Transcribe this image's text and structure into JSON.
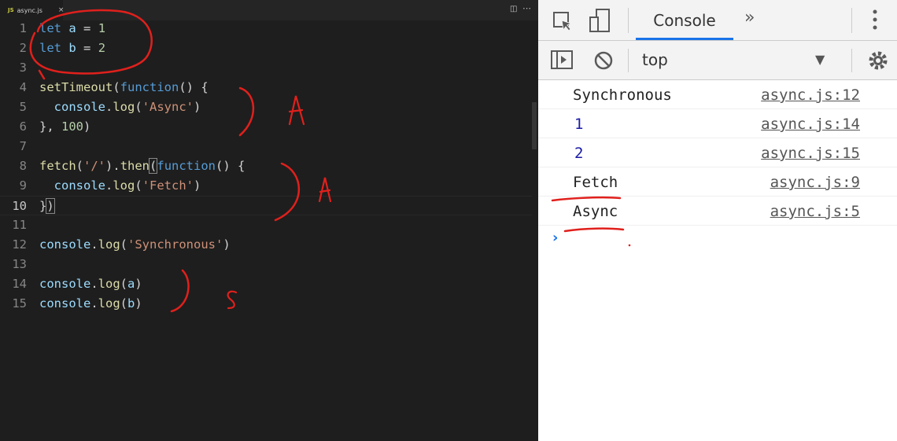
{
  "editor": {
    "tab": {
      "badge": "JS",
      "filename": "async.js",
      "close": "×"
    },
    "lines": [
      {
        "n": "1",
        "tokens": [
          [
            "kw",
            "let"
          ],
          [
            "pun",
            " "
          ],
          [
            "var",
            "a"
          ],
          [
            "pun",
            " = "
          ],
          [
            "num",
            "1"
          ]
        ]
      },
      {
        "n": "2",
        "tokens": [
          [
            "kw",
            "let"
          ],
          [
            "pun",
            " "
          ],
          [
            "var",
            "b"
          ],
          [
            "pun",
            " = "
          ],
          [
            "num",
            "2"
          ]
        ]
      },
      {
        "n": "3",
        "tokens": []
      },
      {
        "n": "4",
        "tokens": [
          [
            "fn",
            "setTimeout"
          ],
          [
            "pun",
            "("
          ],
          [
            "kw",
            "function"
          ],
          [
            "pun",
            "() {"
          ]
        ]
      },
      {
        "n": "5",
        "tokens": [
          [
            "pun",
            "  "
          ],
          [
            "var",
            "console"
          ],
          [
            "pun",
            "."
          ],
          [
            "fn",
            "log"
          ],
          [
            "pun",
            "("
          ],
          [
            "str",
            "'Async'"
          ],
          [
            "pun",
            ")"
          ]
        ]
      },
      {
        "n": "6",
        "tokens": [
          [
            "pun",
            "}, "
          ],
          [
            "num",
            "100"
          ],
          [
            "pun",
            ")"
          ]
        ]
      },
      {
        "n": "7",
        "tokens": []
      },
      {
        "n": "8",
        "tokens": [
          [
            "fn",
            "fetch"
          ],
          [
            "pun",
            "("
          ],
          [
            "str",
            "'/'"
          ],
          [
            "pun",
            ")."
          ],
          [
            "fn",
            "then"
          ],
          [
            "brk",
            "("
          ],
          [
            "kw",
            "function"
          ],
          [
            "pun",
            "() {"
          ]
        ]
      },
      {
        "n": "9",
        "tokens": [
          [
            "pun",
            "  "
          ],
          [
            "var",
            "console"
          ],
          [
            "pun",
            "."
          ],
          [
            "fn",
            "log"
          ],
          [
            "pun",
            "("
          ],
          [
            "str",
            "'Fetch'"
          ],
          [
            "pun",
            ")"
          ]
        ]
      },
      {
        "n": "10",
        "tokens": [
          [
            "pun",
            "}"
          ],
          [
            "brk",
            ")"
          ]
        ],
        "current": true
      },
      {
        "n": "11",
        "tokens": []
      },
      {
        "n": "12",
        "tokens": [
          [
            "var",
            "console"
          ],
          [
            "pun",
            "."
          ],
          [
            "fn",
            "log"
          ],
          [
            "pun",
            "("
          ],
          [
            "str",
            "'Synchronous'"
          ],
          [
            "pun",
            ")"
          ]
        ]
      },
      {
        "n": "13",
        "tokens": []
      },
      {
        "n": "14",
        "tokens": [
          [
            "var",
            "console"
          ],
          [
            "pun",
            "."
          ],
          [
            "fn",
            "log"
          ],
          [
            "pun",
            "("
          ],
          [
            "var",
            "a"
          ],
          [
            "pun",
            ")"
          ]
        ]
      },
      {
        "n": "15",
        "tokens": [
          [
            "var",
            "console"
          ],
          [
            "pun",
            "."
          ],
          [
            "fn",
            "log"
          ],
          [
            "pun",
            "("
          ],
          [
            "var",
            "b"
          ],
          [
            "pun",
            ")"
          ]
        ]
      }
    ],
    "annotations": {
      "async_mark": "A",
      "sync_mark": "S",
      "ink_color": "#e0201c"
    }
  },
  "devtools": {
    "tabs": {
      "console": "Console"
    },
    "context": "top",
    "messages": [
      {
        "text": "Synchronous",
        "source": "async.js:12",
        "type": "string"
      },
      {
        "text": "1",
        "source": "async.js:14",
        "type": "number"
      },
      {
        "text": "2",
        "source": "async.js:15",
        "type": "number"
      },
      {
        "text": "Fetch",
        "source": "async.js:9",
        "type": "string"
      },
      {
        "text": "Async",
        "source": "async.js:5",
        "type": "string"
      }
    ],
    "prompt_glyph": "›",
    "accent": "#1a73e8"
  }
}
